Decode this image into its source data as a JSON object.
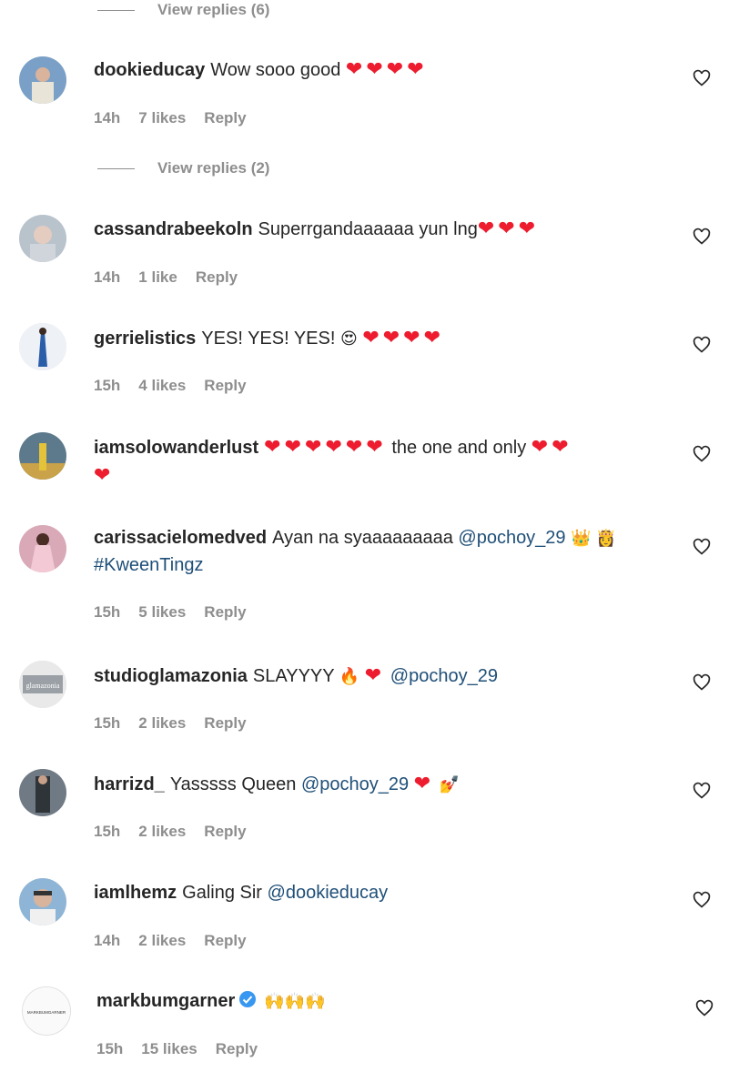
{
  "view_replies_top": "View replies (6)",
  "view_replies_mid": "View replies (2)",
  "comments": [
    {
      "user": "dookieducay",
      "text": "Wow sooo good",
      "hearts": "❤❤❤❤",
      "time": "14h",
      "likes": "7 likes",
      "reply": "Reply",
      "avatar_color": "#7aa0c8"
    },
    {
      "user": "cassandrabeekoln",
      "text": "Superrgandaaaaaa yun lng",
      "hearts": "❤❤❤",
      "time": "14h",
      "likes": "1 like",
      "reply": "Reply",
      "avatar_color": "#b9c3cc"
    },
    {
      "user": "gerrielistics",
      "text": "YES! YES! YES!",
      "emoji": "😍",
      "hearts": "❤❤❤❤",
      "time": "15h",
      "likes": "4 likes",
      "reply": "Reply",
      "avatar_color": "#b0c4e4"
    },
    {
      "user": "iamsolowanderlust",
      "hearts1": "❤❤❤❤❤❤",
      "text": "the one and only",
      "hearts2": "❤❤",
      "hearts3": "❤",
      "avatar_color": "#c9a24a"
    },
    {
      "user": "carissacielomedved",
      "text": "Ayan na syaaaaaaaaa",
      "mention": "@pochoy_29",
      "emoji": "👑 👸",
      "text2": "#KweenTingz",
      "time": "15h",
      "likes": "5 likes",
      "reply": "Reply",
      "avatar_color": "#d9a9b8"
    },
    {
      "user": "studioglamazonia",
      "text": "SLAYYYY",
      "emoji": "🔥",
      "hearts": "❤",
      "mention": "@pochoy_29",
      "time": "15h",
      "likes": "2 likes",
      "reply": "Reply",
      "avatar_color": "#9aa0a6",
      "avatar_text": "glamazonia"
    },
    {
      "user": "harrizd_",
      "text": "Yasssss Queen",
      "mention": "@pochoy_29",
      "hearts": "❤",
      "emoji": "💅",
      "time": "15h",
      "likes": "2 likes",
      "reply": "Reply",
      "avatar_color": "#6f7a84"
    },
    {
      "user": "iamlhemz",
      "text": "Galing Sir",
      "mention": "@dookieducay",
      "time": "14h",
      "likes": "2 likes",
      "reply": "Reply",
      "avatar_color": "#8fb5d6"
    },
    {
      "user": "markbumgarner",
      "emoji": "🙌🙌🙌",
      "time": "15h",
      "likes": "15 likes",
      "reply": "Reply",
      "avatar_color": "#f4f4f4",
      "avatar_text": "MARKBUMGARNER"
    }
  ]
}
